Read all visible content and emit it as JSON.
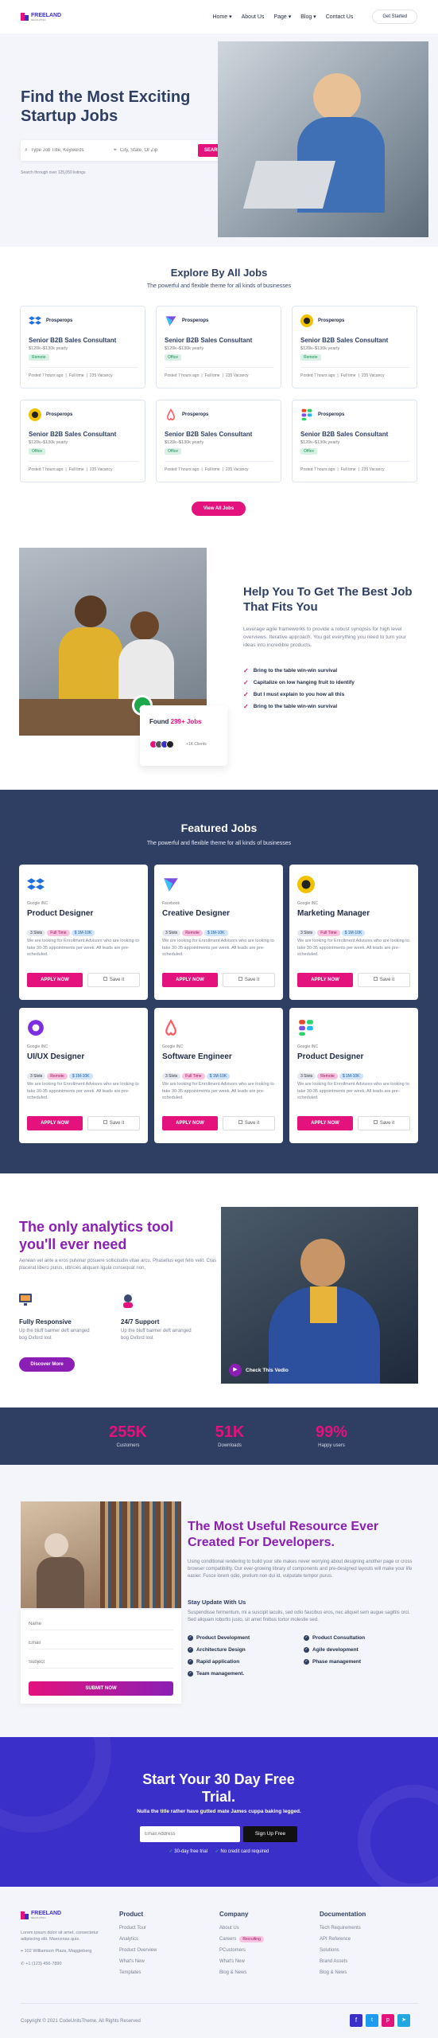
{
  "brand": {
    "name": "FREELAND",
    "sub": "RECRUITING"
  },
  "nav": {
    "items": [
      "Home ▾",
      "About Us",
      "Page ▾",
      "Blog ▾",
      "Contact Us"
    ],
    "cta": "Get Started"
  },
  "hero": {
    "title": "Find the Most Exciting Startup Jobs",
    "search_placeholder": "Type Job Title, Keywords",
    "location_placeholder": "City, State, Or Zip",
    "search_button": "SEARCH",
    "note": "Search through over 125,050 listings"
  },
  "explore": {
    "title": "Explore By All Jobs",
    "subtitle": "The powerful and flexible theme for all kinds of businesses",
    "view_all": "View All Jobs",
    "cards": [
      {
        "company": "Prosperops",
        "title": "Senior B2B Sales Consultant",
        "salary": "$120k–$130k yearly",
        "tag": "Remote",
        "meta": [
          "Posted 7 hours ago",
          "Full time",
          "235 Vacancy"
        ]
      },
      {
        "company": "Prosperops",
        "title": "Senior B2B Sales Consultant",
        "salary": "$120k–$130k yearly",
        "tag": "Office",
        "meta": [
          "Posted 7 hours ago",
          "Full time",
          "235 Vacancy"
        ]
      },
      {
        "company": "Prosperops",
        "title": "Senior B2B Sales Consultant",
        "salary": "$120k–$130k yearly",
        "tag": "Remote",
        "meta": [
          "Posted 7 hours ago",
          "Full time",
          "235 Vacancy"
        ]
      },
      {
        "company": "Prosperops",
        "title": "Senior B2B Sales Consultant",
        "salary": "$120k–$130k yearly",
        "tag": "Office",
        "meta": [
          "Posted 7 hours ago",
          "Full time",
          "235 Vacancy"
        ]
      },
      {
        "company": "Prosperops",
        "title": "Senior B2B Sales Consultant",
        "salary": "$120k–$130k yearly",
        "tag": "Office",
        "meta": [
          "Posted 7 hours ago",
          "Full time",
          "235 Vacancy"
        ]
      },
      {
        "company": "Prosperops",
        "title": "Senior B2B Sales Consultant",
        "salary": "$120k–$130k yearly",
        "tag": "Office",
        "meta": [
          "Posted 7 hours ago",
          "Full time",
          "235 Vacancy"
        ]
      }
    ]
  },
  "help": {
    "title": "Help You To Get The Best Job That Fits You",
    "body": "Leverage agile frameworks to provide a robust synopsis for high level overviews. Iterative approach. You get everything you need to turn your ideas into incredible products.",
    "bullets": [
      "Bring to the table win-win survival",
      "Capitalize on low hanging fruit to identify",
      "But I must explain to you how all this",
      "Bring to the table win-win survival"
    ],
    "found_prefix": "Found ",
    "found_count": "299+ Jobs",
    "clients": "+1K Clients"
  },
  "featured": {
    "title": "Featured Jobs",
    "subtitle": "The powerful and flexible theme for all kinds of businesses",
    "apply": "APPLY NOW",
    "save": "Save it",
    "desc": "We are looking for Enrollment Advisors who are looking to take 30-35 appointments per week. All leads are pre-scheduled.",
    "cards": [
      {
        "company": "Google INC",
        "title": "Product Designer",
        "tags": [
          "3 Slots",
          "Full Time",
          "$ 1M-10K"
        ]
      },
      {
        "company": "Facebook",
        "title": "Creative Designer",
        "tags": [
          "3 Slots",
          "Remote",
          "$ 1M-10K"
        ]
      },
      {
        "company": "Google INC",
        "title": "Marketing Manager",
        "tags": [
          "3 Slots",
          "Full Time",
          "$ 1M-10K"
        ]
      },
      {
        "company": "Google INC",
        "title": "UI/UX Designer",
        "tags": [
          "3 Slots",
          "Remote",
          "$ 1M-10K"
        ]
      },
      {
        "company": "Google INC",
        "title": "Software Engineer",
        "tags": [
          "3 Slots",
          "Full Time",
          "$ 1M-10K"
        ]
      },
      {
        "company": "Google INC",
        "title": "Product Designer",
        "tags": [
          "3 Slots",
          "Remote",
          "$ 1M-10K"
        ]
      }
    ]
  },
  "analytics": {
    "title": "The only analytics tool you'll ever need",
    "body": "Aenean vel ante a eros pulvinar posuere sollicitudin vitae arcu. Phasellus eget felis velit. Cras placerat libero purus, ultricies aliquam ligula consequat non.",
    "f1_title": "Fully Responsive",
    "f1_body": "Up the bluff barmer deft arranged bog Oxford lost",
    "f2_title": "24/7 Support",
    "f2_body": "Up the bluff barmer deft arranged bog Oxford lost",
    "cta": "Discover More",
    "video": "Check This Vedio"
  },
  "stats": [
    {
      "value": "255K",
      "label": "Customers"
    },
    {
      "value": "51K",
      "label": "Downloads"
    },
    {
      "value": "99%",
      "label": "Happy users"
    }
  ],
  "resource": {
    "title": "The Most Useful Resource Ever Created For Developers.",
    "body": "Using conditional rendering to build your site makes never worrying about designing another page or cross browser compatibility. Our ever-growing library of components and pre-designed layouts will make your life easier. Fusce lorem odio, pretium non dui id, vulputate tempor purus.",
    "stay_title": "Stay Update With Us",
    "stay_body": "Suspendisse fermentum, mi a suscipit iaculis, sed odio faucibus eros, nec aliquet sem augue sagittis orci. Sed aliquam lobortis justo, sit amet finibus tortor molestie sed.",
    "list": [
      "Product Development",
      "Product Consultation",
      "Architecture Design",
      "Agile development",
      "Rapid application",
      "Phase management",
      "Team management."
    ],
    "form": {
      "name": "Name",
      "email": "Email",
      "subject": "Subject",
      "submit": "SUBMIT NOW"
    }
  },
  "trial": {
    "title": "Start Your 30 Day Free Trial.",
    "subtitle": "Nulla the title rather have gutted mate James cuppa baking legged.",
    "email_placeholder": "Email Address",
    "button": "Sign Up Free",
    "checks": [
      "30-day free trial",
      "No credit card required"
    ]
  },
  "footer": {
    "about": "Lorem ipsum dolor sit amet, consectetur adipiscing elit. Maecenas quis.",
    "address": "102 Williamson Plaza, Maggieberg",
    "phone": "+1 (123) 456-7890",
    "cols": [
      {
        "title": "Product",
        "items": [
          "Product Tour",
          "Analytics",
          "Product Overview",
          "What's New",
          "Templates"
        ]
      },
      {
        "title": "Company",
        "items": [
          "About Us",
          "Careers",
          "PCustomers",
          "What's New",
          "Blog & News"
        ],
        "badge": "Recruiting"
      },
      {
        "title": "Documentation",
        "items": [
          "Tech Requirements",
          "API Reference",
          "Solutions",
          "Brand Assets",
          "Blog & News"
        ]
      }
    ],
    "copyright": "Copyright © 2021 CodeUnitsTheme. All Rights Reserved"
  },
  "colors": {
    "pink": "#e3127d",
    "navy": "#2f3e63",
    "purple": "#3b2fc9",
    "violet": "#8b1fb5"
  }
}
